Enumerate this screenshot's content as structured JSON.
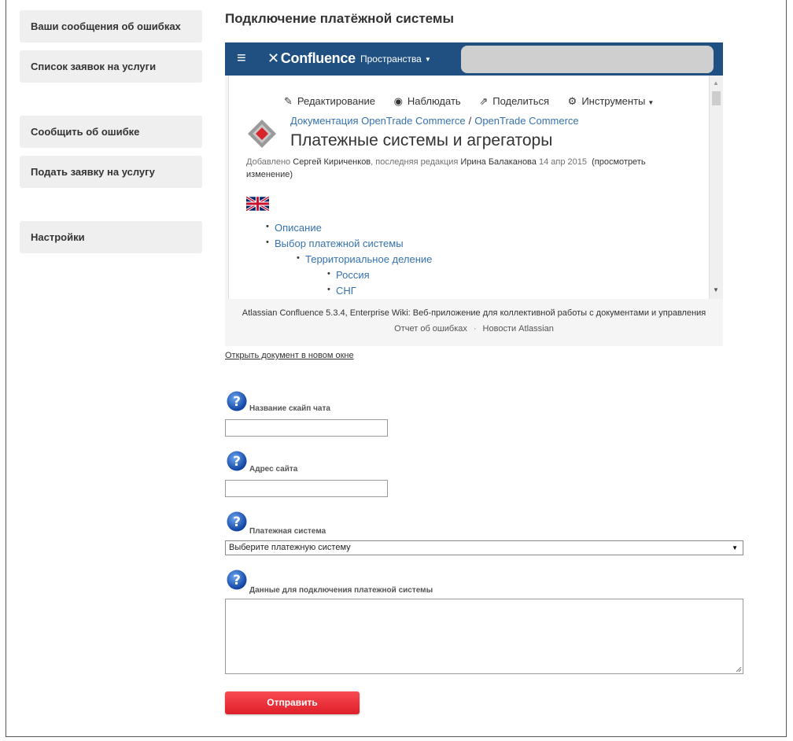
{
  "sidebar": {
    "items": [
      {
        "label": "Ваши сообщения об ошибках"
      },
      {
        "label": "Список заявок на услуги"
      },
      {
        "label": "Сообщить об ошибке"
      },
      {
        "label": "Подать заявку на услугу"
      },
      {
        "label": "Настройки"
      }
    ]
  },
  "page": {
    "title": "Подключение платёжной системы",
    "open_link": "Открыть документ в новом окне"
  },
  "confluence": {
    "logo": "Confluence",
    "spaces": "Пространства",
    "toolbar": {
      "edit": "Редактирование",
      "watch": "Наблюдать",
      "share": "Поделиться",
      "tools": "Инструменты"
    },
    "breadcrumb": [
      "Документация OpenTrade Commerce",
      "OpenTrade Commerce"
    ],
    "title": "Платежные системы и агрегаторы",
    "meta": {
      "added": "Добавлено",
      "author": "Сергей Кириченков",
      "last_edit": ", последняя редакция",
      "editor": "Ирина Балаканова",
      "date": "14 апр 2015",
      "view_change_1": "(просмотреть",
      "view_change_2": "изменение)"
    },
    "toc": [
      {
        "label": "Описание",
        "level": 1
      },
      {
        "label": "Выбор платежной системы",
        "level": 1
      },
      {
        "label": "Территориальное деление",
        "level": 2
      },
      {
        "label": "Россия",
        "level": 3
      },
      {
        "label": "СНГ",
        "level": 3
      }
    ],
    "footer": {
      "line1": "Atlassian Confluence 5.3.4, Enterprise Wiki: Веб-приложение для коллективной работы с документами и управления",
      "bug_report": "Отчет об ошибках",
      "news": "Новости Atlassian"
    }
  },
  "form": {
    "skype_label": "Название скайп чата",
    "skype_value": "",
    "site_label": "Адрес сайта",
    "site_value": "",
    "payment_label": "Платежная система",
    "payment_selected": "Выберите платежную систему",
    "data_label": "Данные для подключения платежной системы",
    "submit": "Отправить"
  },
  "colors": {
    "confluence_header": "#205081",
    "link": "#3572b0",
    "submit": "#e8262f"
  }
}
